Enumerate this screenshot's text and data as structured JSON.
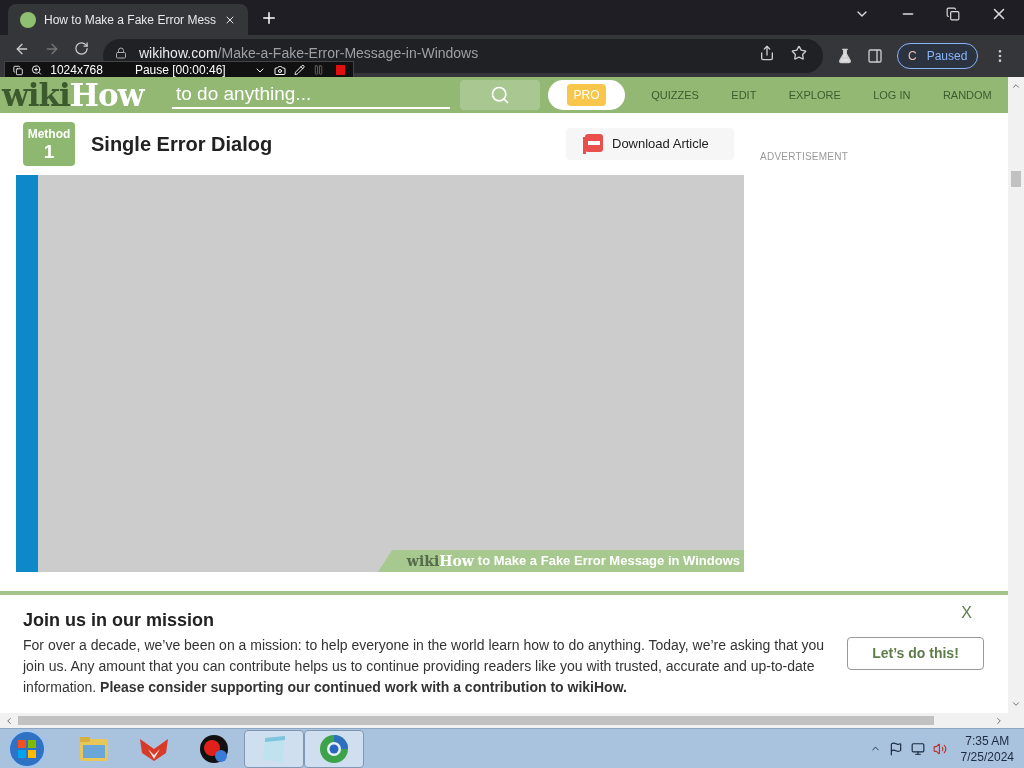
{
  "browser": {
    "tab": {
      "title": "How to Make a Fake Error Mess",
      "selected": true
    },
    "url_host": "wikihow.com",
    "url_path": "/Make-a-Fake-Error-Message-in-Windows",
    "profile_initial": "C",
    "profile_status": "Paused"
  },
  "recorder": {
    "resolution": "1024x768",
    "status": "Pause [00:00:46]"
  },
  "site": {
    "logo": [
      "wiki",
      "How"
    ],
    "search_placeholder": "to do anything...",
    "pro": "PRO",
    "nav": [
      "QUIZZES",
      "EDIT",
      "EXPLORE",
      "LOG IN",
      "RANDOM"
    ]
  },
  "article": {
    "method_label": "Method",
    "method_number": "1",
    "title": "Single Error Dialog",
    "download": "Download Article",
    "caption_logo": [
      "wiki",
      "How"
    ],
    "caption": "to Make a Fake Error Message in Windows"
  },
  "sidebar": {
    "ad_label": "ADVERTISEMENT"
  },
  "banner": {
    "title": "Join us in our mission",
    "body": "For over a decade, we’ve been on a mission: to help everyone in the world learn how to do anything. Today, we’re asking that you join us. Any amount that you can contribute helps us to continue providing readers like you with trusted, accurate and up-to-date information. **Please consider supporting our continued work with a contribution to wikiHow.**",
    "button": "Let’s do this!",
    "close": "X"
  },
  "taskbar": {
    "time": "7:35 AM",
    "date": "7/25/2024",
    "apps": [
      {
        "kind": "folder",
        "selected": false
      },
      {
        "kind": "fox",
        "selected": false
      },
      {
        "kind": "recorder",
        "selected": false
      },
      {
        "kind": "notepad",
        "selected": true
      },
      {
        "kind": "browser",
        "selected": true
      }
    ]
  }
}
